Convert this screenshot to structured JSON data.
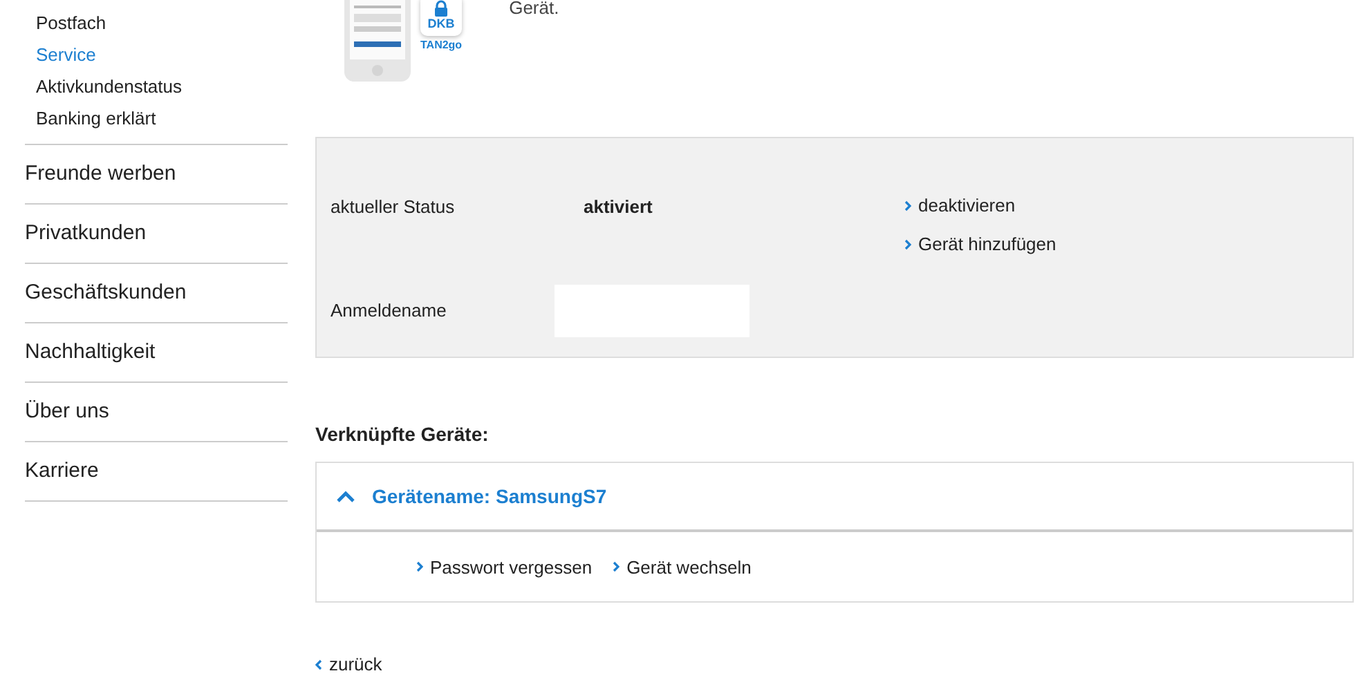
{
  "sidebar": {
    "sub_items": [
      {
        "label": "Postfach",
        "selected": false
      },
      {
        "label": "Service",
        "selected": true
      },
      {
        "label": "Aktivkundenstatus",
        "selected": false
      },
      {
        "label": "Banking erklärt",
        "selected": false
      }
    ],
    "items": [
      "Freunde werben",
      "Privatkunden",
      "Geschäftskunden",
      "Nachhaltigkeit",
      "Über uns",
      "Karriere"
    ]
  },
  "app_promo": {
    "badge_name": "DKB",
    "badge_caption": "TAN2go",
    "text": "Gerät."
  },
  "status_panel": {
    "status_label": "aktueller Status",
    "status_value": "aktiviert",
    "actions": [
      "deaktivieren",
      "Gerät hinzufügen"
    ],
    "login_label": "Anmeldename"
  },
  "devices": {
    "heading": "Verknüpfte Geräte:",
    "items": [
      {
        "title": "Gerätename: SamsungS7",
        "expanded": true,
        "actions": [
          "Passwort vergessen",
          "Gerät wechseln"
        ]
      }
    ]
  },
  "back_link": "zurück"
}
